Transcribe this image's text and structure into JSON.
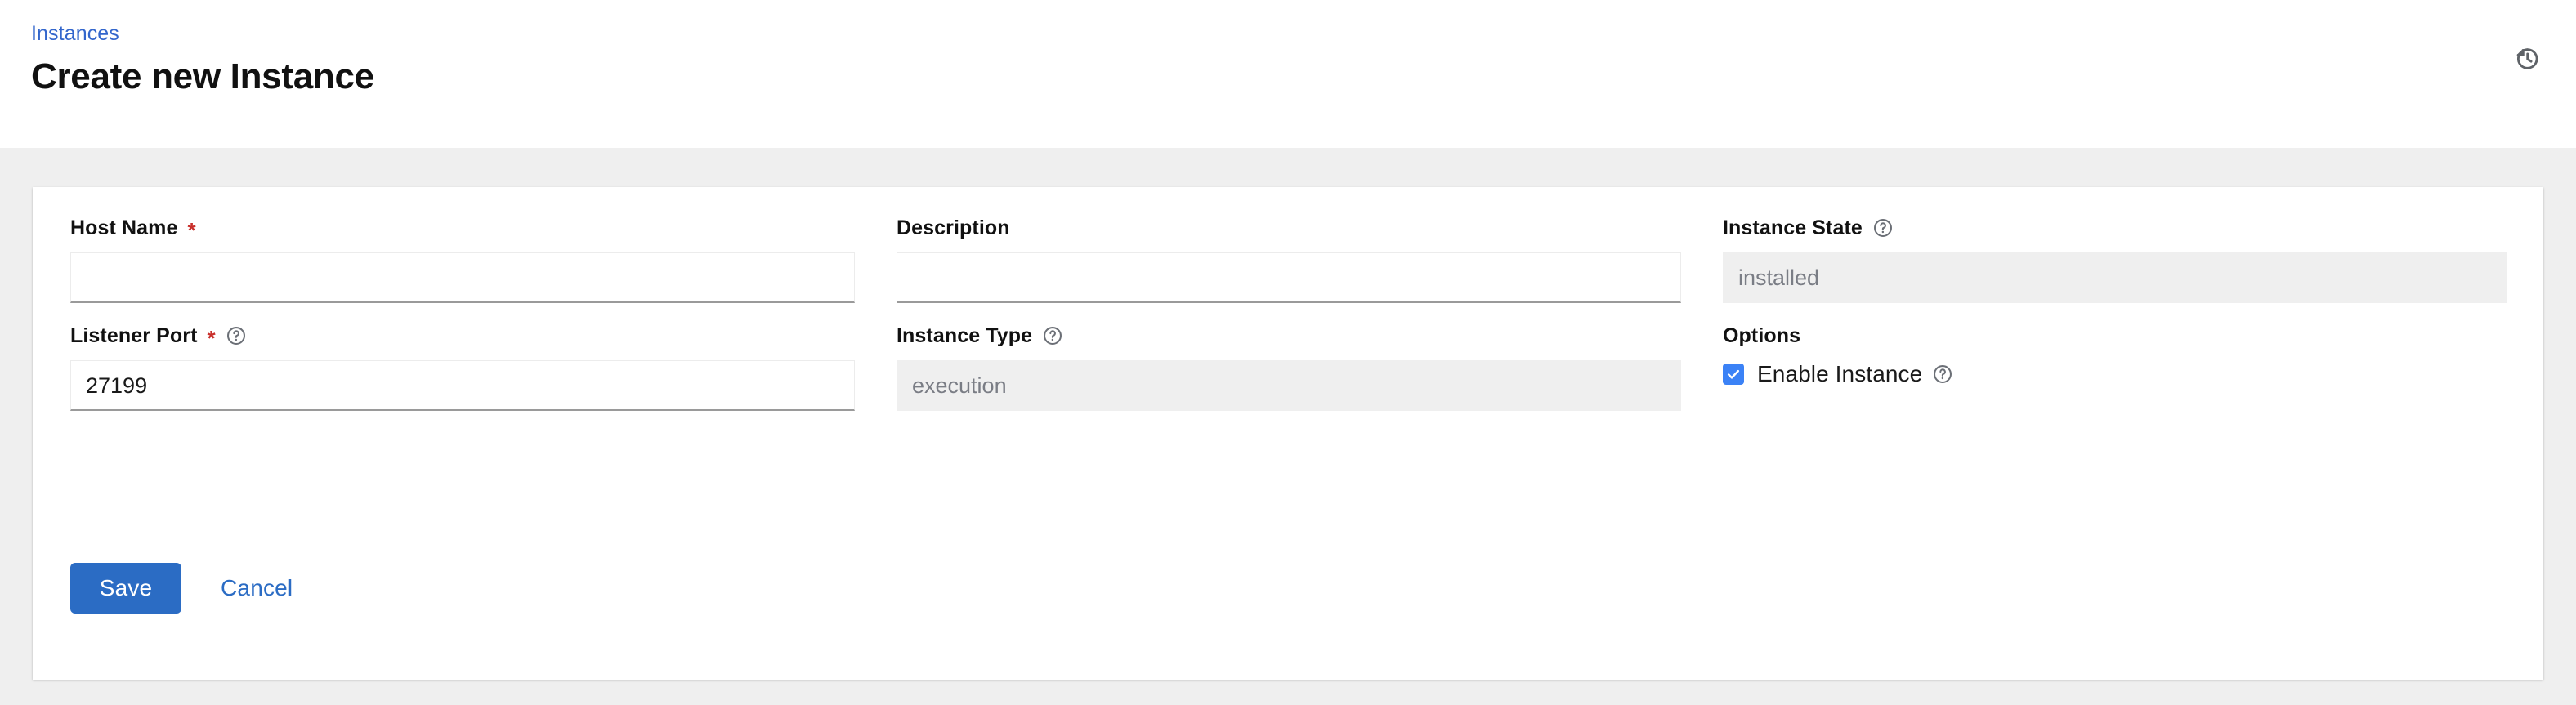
{
  "header": {
    "breadcrumb": "Instances",
    "title": "Create new Instance",
    "history_icon": "history-icon"
  },
  "form": {
    "fields": {
      "host_name": {
        "label": "Host Name",
        "required_marker": "*",
        "value": "",
        "placeholder": "",
        "disabled": false,
        "help": false
      },
      "description": {
        "label": "Description",
        "value": "",
        "placeholder": "",
        "disabled": false,
        "help": false
      },
      "instance_state": {
        "label": "Instance State",
        "value": "installed",
        "disabled": true,
        "help": true,
        "help_icon": "help-circle-icon"
      },
      "listener_port": {
        "label": "Listener Port",
        "required_marker": "*",
        "value": "27199",
        "placeholder": "",
        "disabled": false,
        "help": true,
        "help_icon": "help-circle-icon"
      },
      "instance_type": {
        "label": "Instance Type",
        "value": "execution",
        "disabled": true,
        "help": true,
        "help_icon": "help-circle-icon"
      }
    },
    "options": {
      "label": "Options",
      "enable_instance": {
        "label": "Enable Instance",
        "checked": true,
        "help_icon": "help-circle-icon"
      }
    }
  },
  "actions": {
    "save_label": "Save",
    "cancel_label": "Cancel"
  },
  "colors": {
    "accent_blue": "#2b6cc4",
    "link_blue": "#3366cc",
    "checkbox_blue": "#3b82f6",
    "required_red": "#c9302c",
    "page_background": "#efefef",
    "card_background": "#ffffff",
    "disabled_background": "#efefef",
    "disabled_text": "#7a7d85",
    "icon_gray": "#5f6368"
  }
}
